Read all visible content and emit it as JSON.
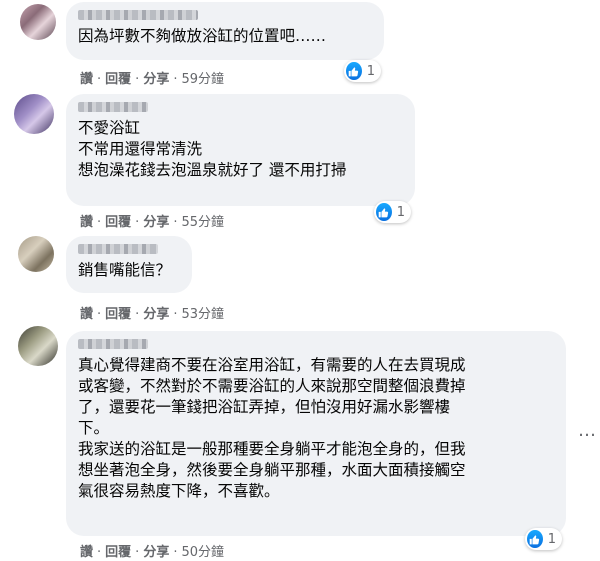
{
  "comments": [
    {
      "lines": [
        "因為坪數不夠做放浴缸的位置吧……"
      ],
      "actions": {
        "like": "讚",
        "reply": "回覆",
        "share": "分享",
        "time": "59分鐘"
      },
      "reactions": {
        "count": "1",
        "icon": "like-icon"
      }
    },
    {
      "lines": [
        "不愛浴缸",
        "不常用還得常清洗",
        "想泡澡花錢去泡溫泉就好了 還不用打掃"
      ],
      "actions": {
        "like": "讚",
        "reply": "回覆",
        "share": "分享",
        "time": "55分鐘"
      },
      "reactions": {
        "count": "1",
        "icon": "like-icon"
      }
    },
    {
      "lines": [
        "銷售嘴能信？"
      ],
      "actions": {
        "like": "讚",
        "reply": "回覆",
        "share": "分享",
        "time": "53分鐘"
      }
    },
    {
      "lines": [
        "真心覺得建商不要在浴室用浴缸，有需要的人在去買現成",
        "或客變，不然對於不需要浴缸的人來說那空間整個浪費掉",
        "了，還要花一筆錢把浴缸弄掉，但怕沒用好漏水影響樓",
        "下。",
        "我家送的浴缸是一般那種要全身躺平才能泡全身的，但我",
        "想坐著泡全身，然後要全身躺平那種，水面大面積接觸空",
        "氣很容易熱度下降，不喜歡。"
      ],
      "actions": {
        "like": "讚",
        "reply": "回覆",
        "share": "分享",
        "time": "50分鐘"
      },
      "reactions": {
        "count": "1",
        "icon": "like-icon"
      }
    }
  ],
  "colors": {
    "bubble": "#f0f2f5",
    "like_blue": "#1877f2",
    "meta_text": "#65676b"
  }
}
